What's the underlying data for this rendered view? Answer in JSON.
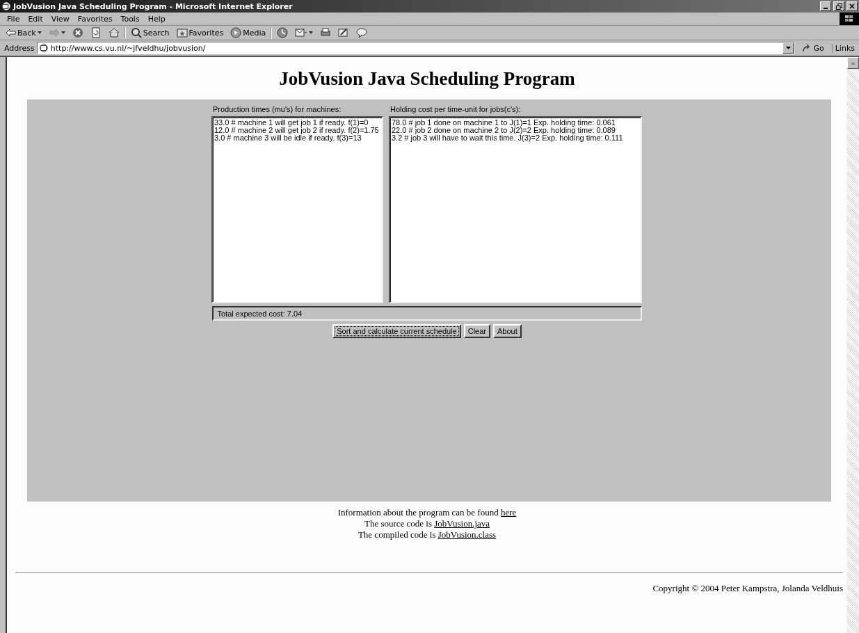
{
  "window": {
    "title": "JobVusion Java Scheduling Program - Microsoft Internet Explorer"
  },
  "menu": [
    "File",
    "Edit",
    "View",
    "Favorites",
    "Tools",
    "Help"
  ],
  "toolbar": [
    {
      "kind": "back",
      "label": "Back"
    },
    {
      "kind": "forward"
    },
    {
      "kind": "stop"
    },
    {
      "kind": "refresh"
    },
    {
      "kind": "home"
    },
    {
      "kind": "search",
      "label": "Search"
    },
    {
      "kind": "favorites",
      "label": "Favorites"
    },
    {
      "kind": "media",
      "label": "Media"
    },
    {
      "kind": "history"
    },
    {
      "kind": "mail"
    },
    {
      "kind": "print"
    },
    {
      "kind": "edit"
    },
    {
      "kind": "discuss"
    }
  ],
  "address": {
    "label": "Address",
    "value": "http://www.cs.vu.nl/~jfveldhu/jobvusion/",
    "go": "Go",
    "links": "Links"
  },
  "page": {
    "heading": "JobVusion Java Scheduling Program",
    "applet": {
      "left_label": "Production times (mu's) for machines:",
      "left_lines": [
        "33.0 # machine 1 will get job 1 if ready. f(1)=0",
        "12.0 # machine 2 will get job 2 if ready. f(2)=1.75",
        "3.0 # machine 3 will be idle if ready. f(3)=13"
      ],
      "right_label": "Holding cost per time-unit for jobs(c's):",
      "right_lines": [
        "78.0 # job 1 done on machine 1 to J(1)=1 Exp. holding time: 0.061",
        "22.0 # job 2 done on machine 2 to J(2)=2 Exp. holding time: 0.089",
        "3.2 # job 3 will have to wait this time. J(3)=2 Exp. holding time: 0.111"
      ],
      "status": "Total expected cost: 7.04",
      "buttons": [
        {
          "label": "Sort and calculate current schedule",
          "focused": true
        },
        {
          "label": "Clear",
          "focused": false
        },
        {
          "label": "About",
          "focused": false
        }
      ]
    },
    "info": [
      {
        "text": "Information about the program can be found ",
        "link": "here"
      },
      {
        "text": "The source code is ",
        "link": "JobVusion.java"
      },
      {
        "text": "The compiled code is ",
        "link": "JobVusion.class"
      }
    ],
    "copyright": "Copyright © 2004 Peter Kampstra, Jolanda Veldhuis"
  }
}
